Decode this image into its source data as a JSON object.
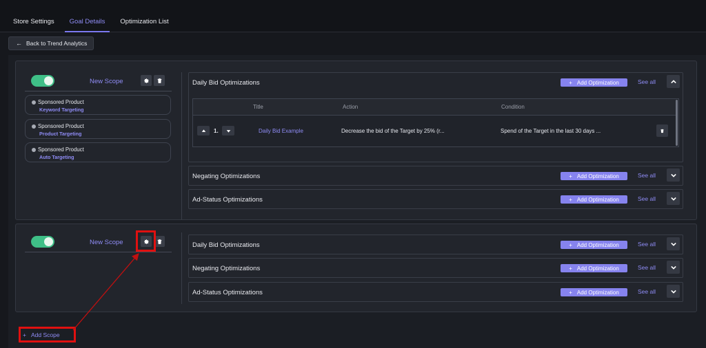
{
  "tabs": [
    {
      "label": "Store Settings",
      "active": false
    },
    {
      "label": "Goal Details",
      "active": true
    },
    {
      "label": "Optimization List",
      "active": false
    }
  ],
  "back_button": {
    "label": "Back to Trend Analytics",
    "icon": "arrow-left-icon"
  },
  "scopes": [
    {
      "name": "New Scope",
      "enabled": true,
      "targets": [
        {
          "product": "Sponsored Product",
          "type": "Keyword Targeting"
        },
        {
          "product": "Sponsored Product",
          "type": "Product Targeting"
        },
        {
          "product": "Sponsored Product",
          "type": "Auto Targeting"
        }
      ],
      "optimizations": [
        {
          "title": "Daily Bid Optimizations",
          "add_label": "Add Optimization",
          "see_all_label": "See all",
          "expanded": true,
          "table": {
            "columns": [
              "Title",
              "Action",
              "Condition"
            ],
            "rows": [
              {
                "index": "1.",
                "title": "Daily Bid Example",
                "action": "Decrease the bid of the Target by 25% (r...",
                "condition": "Spend of the Target in the last 30 days ..."
              }
            ]
          }
        },
        {
          "title": "Negating Optimizations",
          "add_label": "Add Optimization",
          "see_all_label": "See all",
          "expanded": false
        },
        {
          "title": "Ad-Status Optimizations",
          "add_label": "Add Optimization",
          "see_all_label": "See all",
          "expanded": false
        }
      ]
    },
    {
      "name": "New Scope",
      "enabled": true,
      "targets": [],
      "optimizations": [
        {
          "title": "Daily Bid Optimizations",
          "add_label": "Add Optimization",
          "see_all_label": "See all",
          "expanded": false
        },
        {
          "title": "Negating Optimizations",
          "add_label": "Add Optimization",
          "see_all_label": "See all",
          "expanded": false
        },
        {
          "title": "Ad-Status Optimizations",
          "add_label": "Add Optimization",
          "see_all_label": "See all",
          "expanded": false
        }
      ]
    }
  ],
  "add_scope": {
    "label": "Add Scope"
  },
  "colors": {
    "accent": "#8683ee",
    "toggle_on": "#3fbf87",
    "highlight": "#e01010",
    "background": "#16181d"
  }
}
